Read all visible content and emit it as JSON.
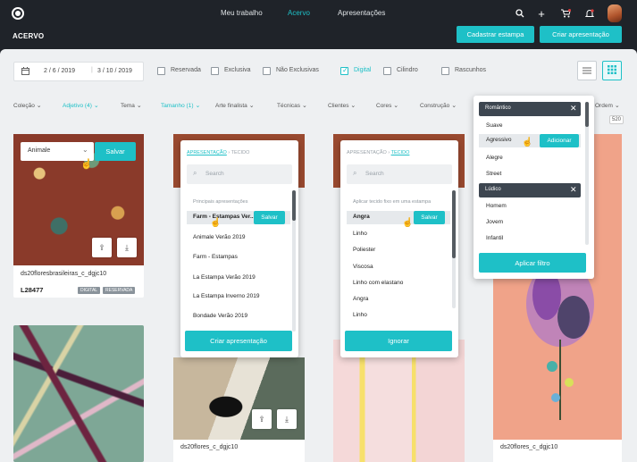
{
  "nav": {
    "links": [
      "Meu trabalho",
      "Acervo",
      "Apresentações"
    ],
    "active": "Acervo"
  },
  "header": {
    "title": "ACERVO",
    "btn_cadastrar": "Cadastrar estampa",
    "btn_criar": "Criar apresentação"
  },
  "filters_bar": {
    "date_from": "2 / 6 / 2019",
    "date_to": "3 / 10 / 2019",
    "checks": [
      {
        "label": "Reservada",
        "checked": false
      },
      {
        "label": "Exclusiva",
        "checked": false
      },
      {
        "label": "Não Exclusivas",
        "checked": false
      },
      {
        "label": "Digital",
        "checked": true
      },
      {
        "label": "Cilindro",
        "checked": false
      },
      {
        "label": "Rascunhos",
        "checked": false
      }
    ]
  },
  "filter_dropdowns": [
    {
      "label": "Coleção",
      "active": false
    },
    {
      "label": "Adjetivo (4)",
      "active": true
    },
    {
      "label": "Tema",
      "active": false
    },
    {
      "label": "Tamanho (1)",
      "active": true
    },
    {
      "label": "Arte finalista",
      "active": false
    },
    {
      "label": "Técnicas",
      "active": false
    },
    {
      "label": "Clientes",
      "active": false
    },
    {
      "label": "Cores",
      "active": false
    },
    {
      "label": "Construção",
      "active": false
    }
  ],
  "sort": {
    "label": "Ordem",
    "count": "520"
  },
  "card1": {
    "select_value": "Animale",
    "save": "Salvar",
    "title": "ds20floresbrasileiras_c_dgjc10",
    "code": "L28477",
    "tags": [
      "DIGITAL",
      "RESERVADA"
    ]
  },
  "card_b1": {
    "title": "ds20flores_c_dgjc10"
  },
  "card_d1": {
    "title": "ds20flores_c_dgjc10"
  },
  "pop_presentation": {
    "crumb_link": "APRESENTAÇÃO",
    "crumb_current": "TECIDO",
    "search_placeholder": "Search",
    "section_label": "Principais apresentações",
    "items": [
      "Farm - Estampas Ver...",
      "Animale Verão 2019",
      "Farm - Estampas",
      "La Estampa Verão 2019",
      "La Estampa Inverno 2019",
      "Bondade Verão 2019"
    ],
    "save": "Salvar",
    "cta": "Criar apresentação"
  },
  "pop_fabric": {
    "crumb_link": "APRESENTAÇÃO",
    "crumb_current": "TECIDO",
    "search_placeholder": "Search",
    "section_label": "Aplicar tecido fixo em uma estampa",
    "items": [
      "Angra",
      "Linho",
      "Poliester",
      "Viscosa",
      "Linho com elastano",
      "Angra",
      "Linho"
    ],
    "save": "Salvar",
    "cta": "Ignorar"
  },
  "pop_adjective": {
    "chip1": "Romântico",
    "items_a": [
      "Suave",
      "Agressivo",
      "Alegre",
      "Street"
    ],
    "add": "Adicionar",
    "chip2": "Lúdico",
    "items_b": [
      "Homem",
      "Jovem",
      "Infantil"
    ],
    "cta": "Aplicar filtro"
  }
}
